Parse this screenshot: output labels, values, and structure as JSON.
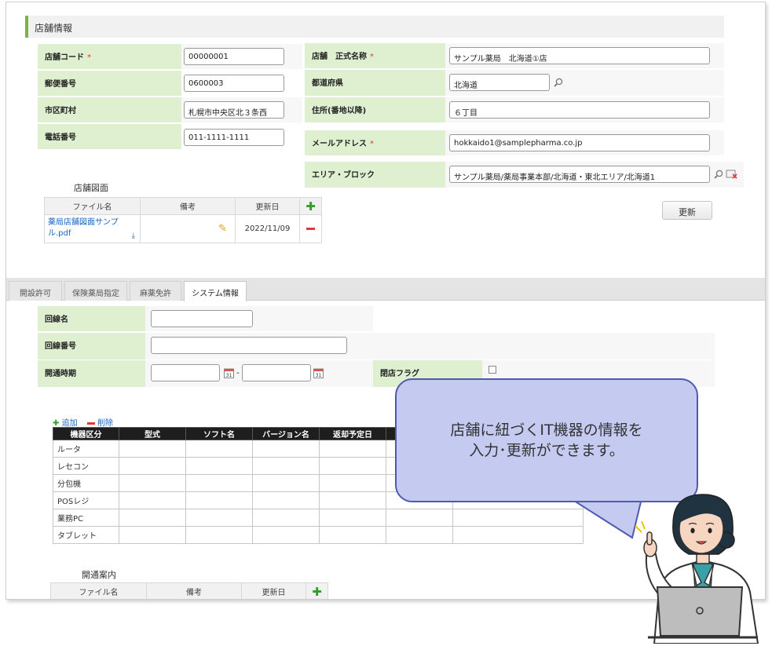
{
  "section_title": "店舗情報",
  "required_mark": "*",
  "store_form": {
    "left": [
      {
        "label": "店舗コード",
        "required": true,
        "value": "00000001"
      },
      {
        "label": "郵便番号",
        "required": false,
        "value": "0600003"
      },
      {
        "label": "市区町村",
        "required": false,
        "value": "札幌市中央区北３条西"
      },
      {
        "label": "電話番号",
        "required": false,
        "value": "011-1111-1111"
      }
    ],
    "right": [
      {
        "label": "店舗　正式名称",
        "required": true,
        "value": "サンプル薬局　北海道①店"
      },
      {
        "label": "都道府県",
        "required": false,
        "value": "北海道"
      },
      {
        "label": "住所(番地以降)",
        "required": false,
        "value": "６丁目"
      },
      {
        "label": "メールアドレス",
        "required": true,
        "value": "hokkaido1@samplepharma.co.jp"
      },
      {
        "label": "エリア・ブロック",
        "required": false,
        "value": "サンプル薬局/薬局事業本部/北海道・東北エリア/北海道1"
      }
    ]
  },
  "floorplan": {
    "title": "店舗図面",
    "headers": [
      "ファイル名",
      "備考",
      "更新日"
    ],
    "row": {
      "file": "薬局店舗図面サンプル.pdf",
      "note": "",
      "date": "2022/11/09"
    }
  },
  "update_button": "更新",
  "tabs": [
    "開設許可",
    "保険薬局指定",
    "麻薬免許",
    "システム情報"
  ],
  "active_tab": 3,
  "system": {
    "line_name_label": "回線名",
    "line_name_value": "",
    "line_number_label": "回線番号",
    "line_number_value": "",
    "open_period_label": "開通時期",
    "date_separator": "-",
    "close_flag_label": "閉店フラグ"
  },
  "equipment": {
    "add_label": "追加",
    "delete_label": "削除",
    "headers": [
      "機器区分",
      "型式",
      "ソフト名",
      "バージョン名",
      "返却予定日",
      "",
      ""
    ],
    "rows": [
      "ルータ",
      "レセコン",
      "分包機",
      "POSレジ",
      "業務PC",
      "タブレット"
    ]
  },
  "guide": {
    "title": "開通案内",
    "headers": [
      "ファイル名",
      "備考",
      "更新日"
    ]
  },
  "bubble": {
    "line1": "店舗に紐づくIT機器の情報を",
    "line2": "入力･更新ができます。"
  },
  "colors": {
    "label_bg": "#dff0d0",
    "accent_green": "#7cb342",
    "link_blue": "#1565c0",
    "delete_red": "#e53935",
    "bubble_fill": "#c5cbf0",
    "bubble_border": "#4e5ab0"
  }
}
